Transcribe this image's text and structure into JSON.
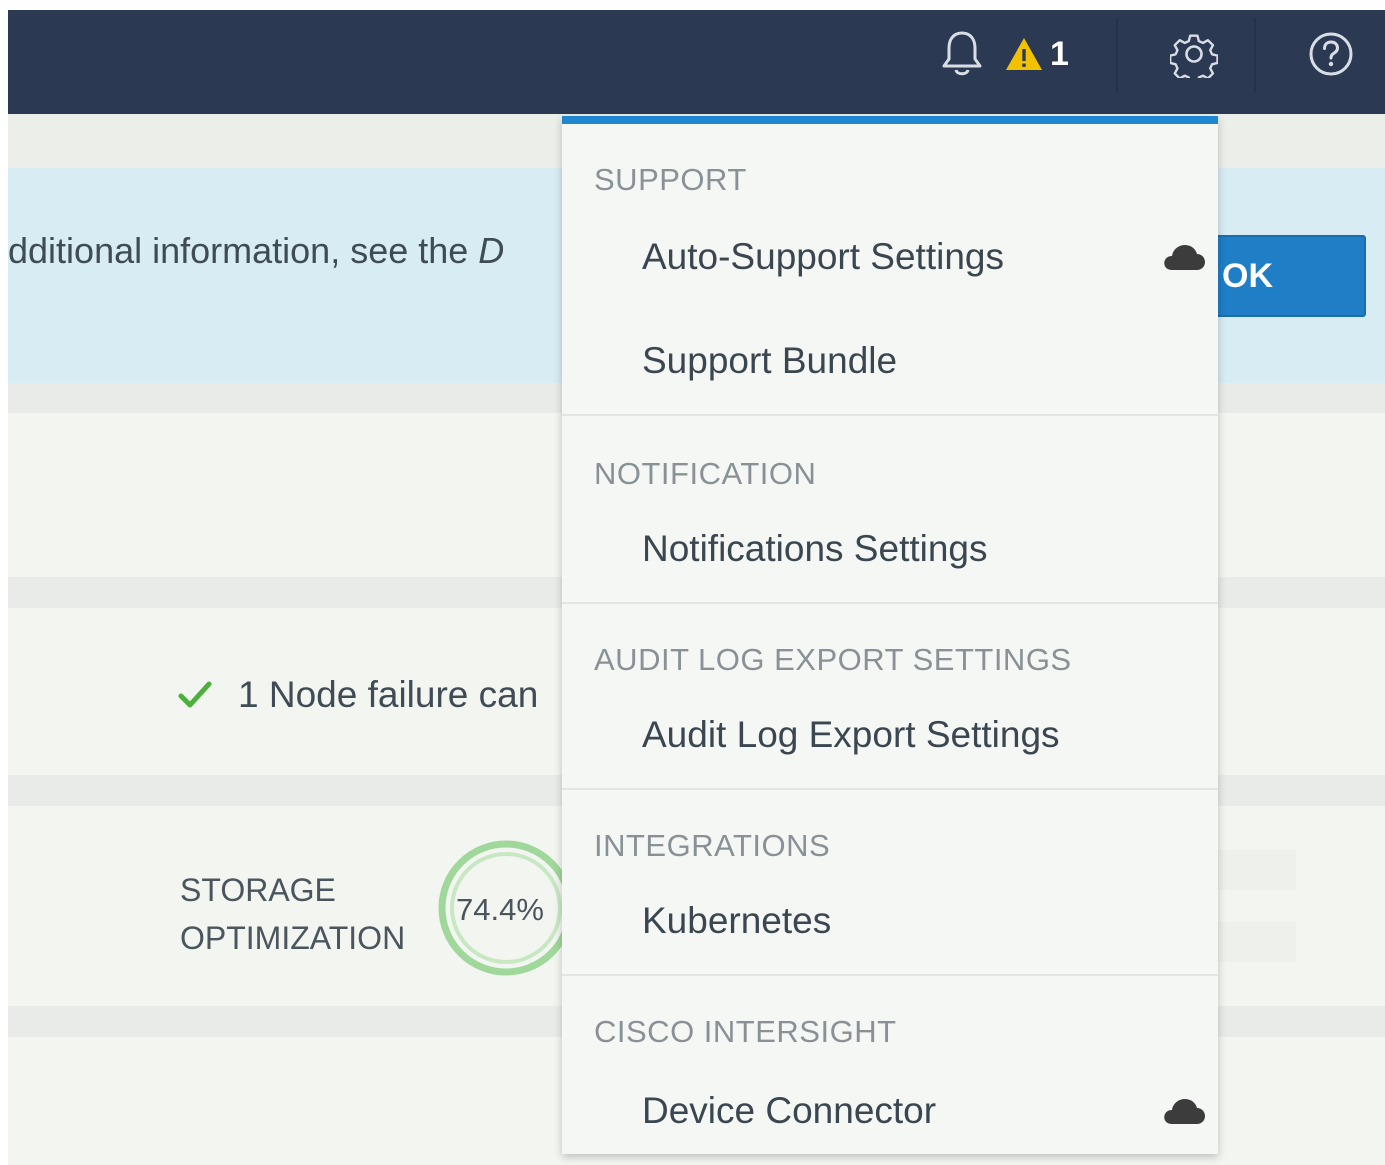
{
  "header": {
    "alert_count": "1",
    "icons": [
      "bell-icon",
      "warning-icon",
      "gear-icon",
      "help-icon"
    ],
    "colors": {
      "bar": "#2b3a52",
      "warning": "#f2c200"
    }
  },
  "banner": {
    "text": "dditional information, see the ",
    "text_italic": "D",
    "ok_label": "OK"
  },
  "status": {
    "node_failure_text": "1 Node failure can"
  },
  "storage": {
    "label_line1": "STORAGE",
    "label_line2": "OPTIMIZATION",
    "value": "74.4%"
  },
  "menu": {
    "accent": "#1f86d0",
    "sections": [
      {
        "heading": "SUPPORT",
        "items": [
          {
            "label": "Auto-Support Settings",
            "icon": "cloud-icon"
          },
          {
            "label": "Support Bundle"
          }
        ]
      },
      {
        "heading": "NOTIFICATION",
        "items": [
          {
            "label": "Notifications Settings"
          }
        ]
      },
      {
        "heading": "AUDIT LOG EXPORT SETTINGS",
        "items": [
          {
            "label": "Audit Log Export Settings"
          }
        ]
      },
      {
        "heading": "INTEGRATIONS",
        "items": [
          {
            "label": "Kubernetes"
          }
        ]
      },
      {
        "heading": "CISCO INTERSIGHT",
        "items": [
          {
            "label": "Device Connector",
            "icon": "cloud-icon"
          }
        ]
      }
    ]
  }
}
